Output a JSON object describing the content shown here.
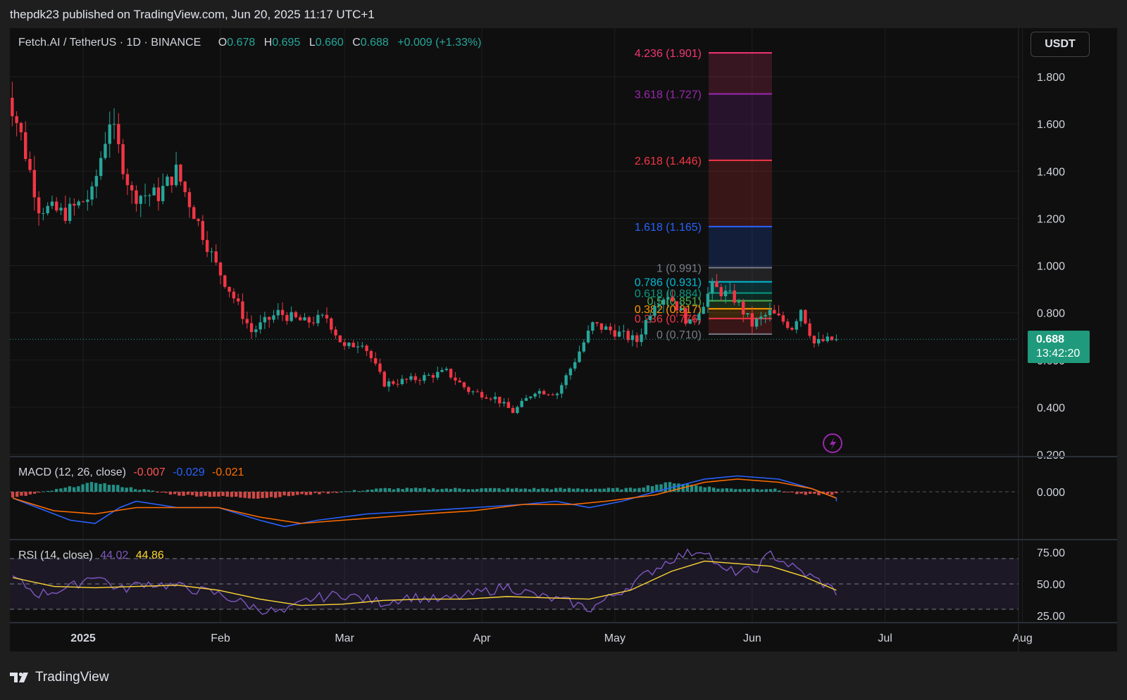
{
  "header": {
    "publisher_line": "thepdk23 published on TradingView.com, Jun 20, 2025 11:17 UTC+1"
  },
  "symbol_legend": {
    "symbol": "Fetch.AI / TetherUS · 1D · BINANCE",
    "open_key": "O",
    "open": "0.678",
    "high_key": "H",
    "high": "0.695",
    "low_key": "L",
    "low": "0.660",
    "close_key": "C",
    "close": "0.688",
    "change": "+0.009 (+1.33%)"
  },
  "currency_button": "USDT",
  "price_tag": {
    "price": "0.688",
    "countdown": "13:42:20"
  },
  "macd_legend": {
    "name": "MACD (12, 26, close)",
    "histogram": "-0.007",
    "macd": "-0.029",
    "signal": "-0.021"
  },
  "rsi_legend": {
    "name": "RSI (14, close)",
    "rsi": "44.02",
    "rsi_ma": "44.86"
  },
  "footer": {
    "brand": "TradingView"
  },
  "colors": {
    "up": "#26a69a",
    "down": "#f23645",
    "macd_line": "#2962ff",
    "signal_line": "#ff6d00",
    "rsi_line": "#7e57c2",
    "rsi_ma": "#fdd835",
    "background": "#0f0f0f"
  },
  "chart_data": [
    {
      "type": "candlestick",
      "title": "Fetch.AI / TetherUS · 1D · BINANCE",
      "y_axis": {
        "ticks": [
          "1.800",
          "1.600",
          "1.400",
          "1.200",
          "1.000",
          "0.800",
          "0.600",
          "0.400",
          "0.200"
        ],
        "ylim": [
          0.2,
          1.8
        ]
      },
      "x_axis": {
        "ticks": [
          "2025",
          "Feb",
          "Mar",
          "Apr",
          "May",
          "Jun",
          "Jul",
          "Aug"
        ],
        "range": [
          "2024-12-14",
          "2025-08-01"
        ]
      },
      "last_price": 0.688,
      "close_path": [
        [
          "2024-12-14",
          1.8
        ],
        [
          "2024-12-18",
          1.55
        ],
        [
          "2024-12-22",
          1.25
        ],
        [
          "2024-12-28",
          1.22
        ],
        [
          "2025-01-03",
          1.3
        ],
        [
          "2025-01-07",
          1.62
        ],
        [
          "2025-01-12",
          1.3
        ],
        [
          "2025-01-18",
          1.3
        ],
        [
          "2025-01-22",
          1.4
        ],
        [
          "2025-01-27",
          1.18
        ],
        [
          "2025-01-31",
          1.0
        ],
        [
          "2025-02-03",
          0.9
        ],
        [
          "2025-02-08",
          0.72
        ],
        [
          "2025-02-14",
          0.8
        ],
        [
          "2025-02-20",
          0.76
        ],
        [
          "2025-02-25",
          0.78
        ],
        [
          "2025-03-01",
          0.65
        ],
        [
          "2025-03-05",
          0.68
        ],
        [
          "2025-03-10",
          0.5
        ],
        [
          "2025-03-17",
          0.52
        ],
        [
          "2025-03-24",
          0.55
        ],
        [
          "2025-03-29",
          0.47
        ],
        [
          "2025-04-04",
          0.44
        ],
        [
          "2025-04-08",
          0.38
        ],
        [
          "2025-04-13",
          0.47
        ],
        [
          "2025-04-18",
          0.46
        ],
        [
          "2025-04-22",
          0.6
        ],
        [
          "2025-04-26",
          0.75
        ],
        [
          "2025-05-01",
          0.72
        ],
        [
          "2025-05-06",
          0.68
        ],
        [
          "2025-05-10",
          0.85
        ],
        [
          "2025-05-13",
          0.88
        ],
        [
          "2025-05-18",
          0.75
        ],
        [
          "2025-05-23",
          0.91
        ],
        [
          "2025-05-28",
          0.86
        ],
        [
          "2025-06-01",
          0.75
        ],
        [
          "2025-06-05",
          0.8
        ],
        [
          "2025-06-10",
          0.74
        ],
        [
          "2025-06-12",
          0.82
        ],
        [
          "2025-06-15",
          0.67
        ],
        [
          "2025-06-17",
          0.68
        ],
        [
          "2025-06-20",
          0.688
        ]
      ],
      "fibonacci_extension": [
        {
          "label": "4.236 (1.901)",
          "ratio": 4.236,
          "price": 1.901,
          "color": "#f23675"
        },
        {
          "label": "3.618 (1.727)",
          "ratio": 3.618,
          "price": 1.727,
          "color": "#9c27b0"
        },
        {
          "label": "2.618 (1.446)",
          "ratio": 2.618,
          "price": 1.446,
          "color": "#f23645"
        },
        {
          "label": "1.618 (1.165)",
          "ratio": 1.618,
          "price": 1.165,
          "color": "#2962ff"
        },
        {
          "label": "1 (0.991)",
          "ratio": 1,
          "price": 0.991,
          "color": "#787b86"
        },
        {
          "label": "0.786 (0.931)",
          "ratio": 0.786,
          "price": 0.931,
          "color": "#00bcd4"
        },
        {
          "label": "0.618 (0.884)",
          "ratio": 0.618,
          "price": 0.884,
          "color": "#089981"
        },
        {
          "label": "0.5 (0.851)",
          "ratio": 0.5,
          "price": 0.851,
          "color": "#4caf50"
        },
        {
          "label": "0.382 (0.817)",
          "ratio": 0.382,
          "price": 0.817,
          "color": "#ff9800"
        },
        {
          "label": "0.236 (0.776)",
          "ratio": 0.236,
          "price": 0.776,
          "color": "#f23645"
        },
        {
          "label": "0 (0.710)",
          "ratio": 0,
          "price": 0.71,
          "color": "#787b86"
        }
      ]
    },
    {
      "type": "line",
      "title": "MACD (12, 26, close)",
      "y_axis": {
        "ticks": [
          "0.000"
        ]
      },
      "series": [
        {
          "name": "MACD",
          "color": "#2962ff",
          "values": [
            [
              0,
              -0.02
            ],
            [
              0.03,
              -0.05
            ],
            [
              0.07,
              -0.09
            ],
            [
              0.1,
              -0.1
            ],
            [
              0.13,
              -0.05
            ],
            [
              0.15,
              -0.03
            ],
            [
              0.2,
              -0.05
            ],
            [
              0.25,
              -0.05
            ],
            [
              0.3,
              -0.09
            ],
            [
              0.33,
              -0.11
            ],
            [
              0.37,
              -0.09
            ],
            [
              0.43,
              -0.07
            ],
            [
              0.5,
              -0.06
            ],
            [
              0.56,
              -0.05
            ],
            [
              0.62,
              -0.04
            ],
            [
              0.66,
              -0.03
            ],
            [
              0.7,
              -0.05
            ],
            [
              0.74,
              -0.03
            ],
            [
              0.78,
              0.0
            ],
            [
              0.84,
              0.04
            ],
            [
              0.88,
              0.05
            ],
            [
              0.93,
              0.04
            ],
            [
              0.97,
              0.01
            ],
            [
              1.0,
              -0.02
            ],
            [
              1.0,
              -0.03
            ]
          ]
        },
        {
          "name": "Signal",
          "color": "#ff6d00",
          "values": [
            [
              0,
              -0.02
            ],
            [
              0.05,
              -0.06
            ],
            [
              0.1,
              -0.07
            ],
            [
              0.15,
              -0.05
            ],
            [
              0.2,
              -0.05
            ],
            [
              0.25,
              -0.05
            ],
            [
              0.3,
              -0.08
            ],
            [
              0.35,
              -0.1
            ],
            [
              0.4,
              -0.09
            ],
            [
              0.45,
              -0.08
            ],
            [
              0.5,
              -0.07
            ],
            [
              0.56,
              -0.06
            ],
            [
              0.62,
              -0.04
            ],
            [
              0.68,
              -0.04
            ],
            [
              0.72,
              -0.03
            ],
            [
              0.78,
              -0.01
            ],
            [
              0.84,
              0.03
            ],
            [
              0.88,
              0.04
            ],
            [
              0.93,
              0.03
            ],
            [
              0.97,
              0.01
            ],
            [
              1.0,
              -0.02
            ]
          ]
        },
        {
          "name": "Histogram",
          "values": [
            [
              0,
              -0.02
            ],
            [
              0.1,
              0.03
            ],
            [
              0.2,
              -0.01
            ],
            [
              0.3,
              -0.02
            ],
            [
              0.45,
              0.01
            ],
            [
              0.6,
              0.01
            ],
            [
              0.75,
              0.01
            ],
            [
              0.8,
              0.03
            ],
            [
              0.86,
              0.01
            ],
            [
              0.92,
              0.01
            ],
            [
              0.96,
              -0.01
            ],
            [
              1.0,
              -0.007
            ]
          ]
        }
      ]
    },
    {
      "type": "line",
      "title": "RSI (14, close)",
      "y_axis": {
        "ticks": [
          "75.00",
          "50.00",
          "25.00"
        ],
        "ylim": [
          25,
          75
        ]
      },
      "bands": [
        70,
        50,
        30
      ],
      "series": [
        {
          "name": "RSI",
          "color": "#7e57c2",
          "values": [
            [
              0,
              55
            ],
            [
              0.03,
              42
            ],
            [
              0.07,
              47
            ],
            [
              0.1,
              58
            ],
            [
              0.13,
              45
            ],
            [
              0.16,
              51
            ],
            [
              0.2,
              48
            ],
            [
              0.25,
              42
            ],
            [
              0.3,
              30
            ],
            [
              0.33,
              27
            ],
            [
              0.36,
              38
            ],
            [
              0.4,
              42
            ],
            [
              0.45,
              35
            ],
            [
              0.48,
              40
            ],
            [
              0.52,
              37
            ],
            [
              0.56,
              42
            ],
            [
              0.6,
              48
            ],
            [
              0.64,
              40
            ],
            [
              0.68,
              35
            ],
            [
              0.7,
              30
            ],
            [
              0.74,
              45
            ],
            [
              0.78,
              62
            ],
            [
              0.8,
              70
            ],
            [
              0.84,
              78
            ],
            [
              0.86,
              60
            ],
            [
              0.9,
              60
            ],
            [
              0.92,
              74
            ],
            [
              0.95,
              62
            ],
            [
              0.98,
              52
            ],
            [
              1.0,
              44
            ]
          ]
        },
        {
          "name": "RSI-based MA",
          "color": "#fdd835",
          "values": [
            [
              0,
              55
            ],
            [
              0.05,
              48
            ],
            [
              0.1,
              47
            ],
            [
              0.15,
              48
            ],
            [
              0.2,
              49
            ],
            [
              0.25,
              45
            ],
            [
              0.3,
              38
            ],
            [
              0.35,
              33
            ],
            [
              0.4,
              34
            ],
            [
              0.45,
              37
            ],
            [
              0.5,
              38
            ],
            [
              0.55,
              38
            ],
            [
              0.6,
              40
            ],
            [
              0.65,
              39
            ],
            [
              0.7,
              38
            ],
            [
              0.75,
              45
            ],
            [
              0.8,
              60
            ],
            [
              0.84,
              68
            ],
            [
              0.88,
              66
            ],
            [
              0.92,
              64
            ],
            [
              0.96,
              56
            ],
            [
              1.0,
              45
            ]
          ]
        }
      ]
    }
  ]
}
